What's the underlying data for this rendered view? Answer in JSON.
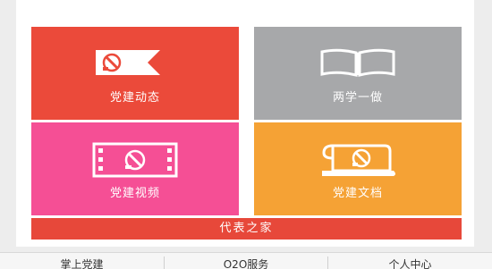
{
  "tiles": {
    "dynamics": {
      "label": "党建动态",
      "icon": "party-flag-icon"
    },
    "study": {
      "label": "两学一做",
      "icon": "open-book-icon"
    },
    "video": {
      "label": "党建视频",
      "icon": "film-strip-icon"
    },
    "docs": {
      "label": "党建文档",
      "icon": "document-scroll-icon"
    }
  },
  "wide_bar": {
    "label": "代表之家"
  },
  "bottom_nav": {
    "items": [
      {
        "label": "掌上党建"
      },
      {
        "label": "O2O服务"
      },
      {
        "label": "个人中心"
      }
    ]
  },
  "colors": {
    "dynamics": "#eb4a3a",
    "study": "#a7a8aa",
    "video": "#f54f95",
    "docs": "#f5a235",
    "wide_bar": "#e7483a"
  }
}
